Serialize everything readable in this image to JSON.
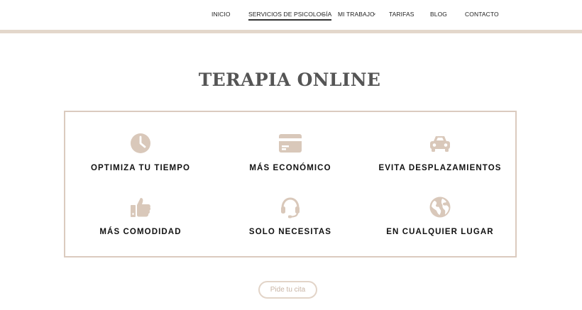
{
  "nav": {
    "items": [
      {
        "label": "INICIO"
      },
      {
        "label": "SERVICIOS DE PSICOLOGÍA"
      },
      {
        "label": "MI TRABAJO"
      },
      {
        "label": "TARIFAS"
      },
      {
        "label": "BLOG"
      },
      {
        "label": "CONTACTO"
      }
    ],
    "active_index": 1
  },
  "section": {
    "title": "TERAPIA ONLINE"
  },
  "features": [
    {
      "icon": "clock-icon",
      "label": "OPTIMIZA TU TIEMPO"
    },
    {
      "icon": "credit-card-icon",
      "label": "MÁS ECONÓMICO"
    },
    {
      "icon": "car-icon",
      "label": "EVITA DESPLAZAMIENTOS"
    },
    {
      "icon": "thumbs-up-icon",
      "label": "MÁS COMODIDAD"
    },
    {
      "icon": "headset-icon",
      "label": "SOLO NECESITAS"
    },
    {
      "icon": "globe-icon",
      "label": "EN CUALQUIER LUGAR"
    }
  ],
  "cta": {
    "label": "Pide tu cita"
  },
  "colors": {
    "accent": "#d9c8ba",
    "text": "#111111",
    "title": "#555555"
  }
}
